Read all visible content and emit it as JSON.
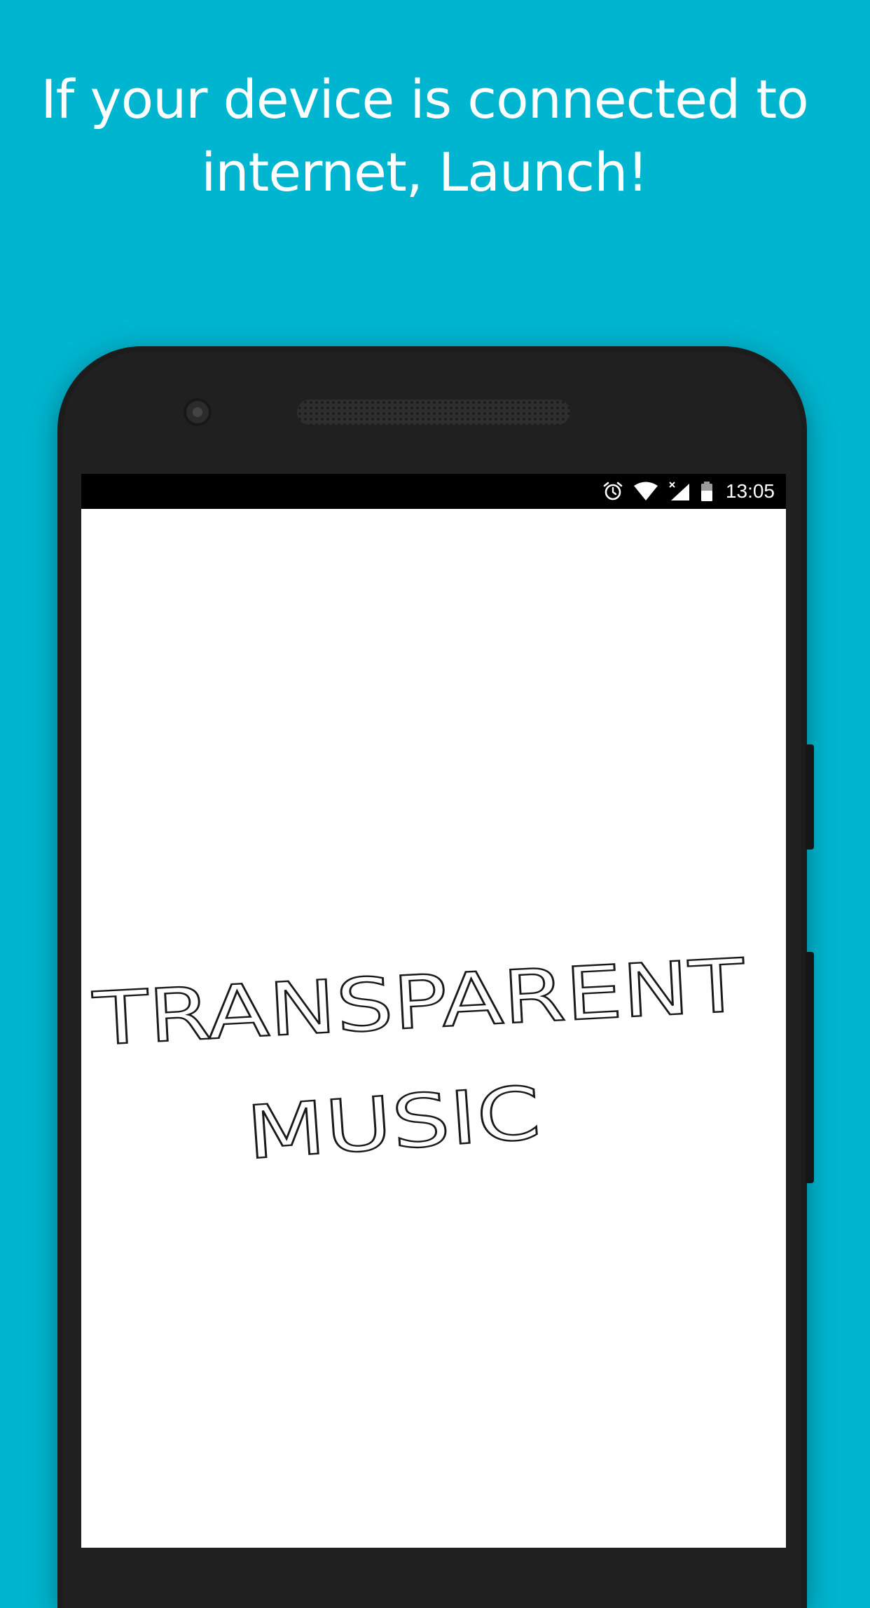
{
  "headline": {
    "line1": "If your device is connected to",
    "line2": "internet, Launch!"
  },
  "statusbar": {
    "time": "13:05",
    "icons": [
      "alarm-icon",
      "wifi-icon",
      "signal-icon",
      "battery-icon"
    ]
  },
  "splash": {
    "title_line1": "TRANSPARENT",
    "title_line2": "MUSIC"
  },
  "colors": {
    "background": "#00b5cf",
    "phone_body": "#1c1c1c",
    "screen": "#ffffff",
    "statusbar": "#000000"
  }
}
